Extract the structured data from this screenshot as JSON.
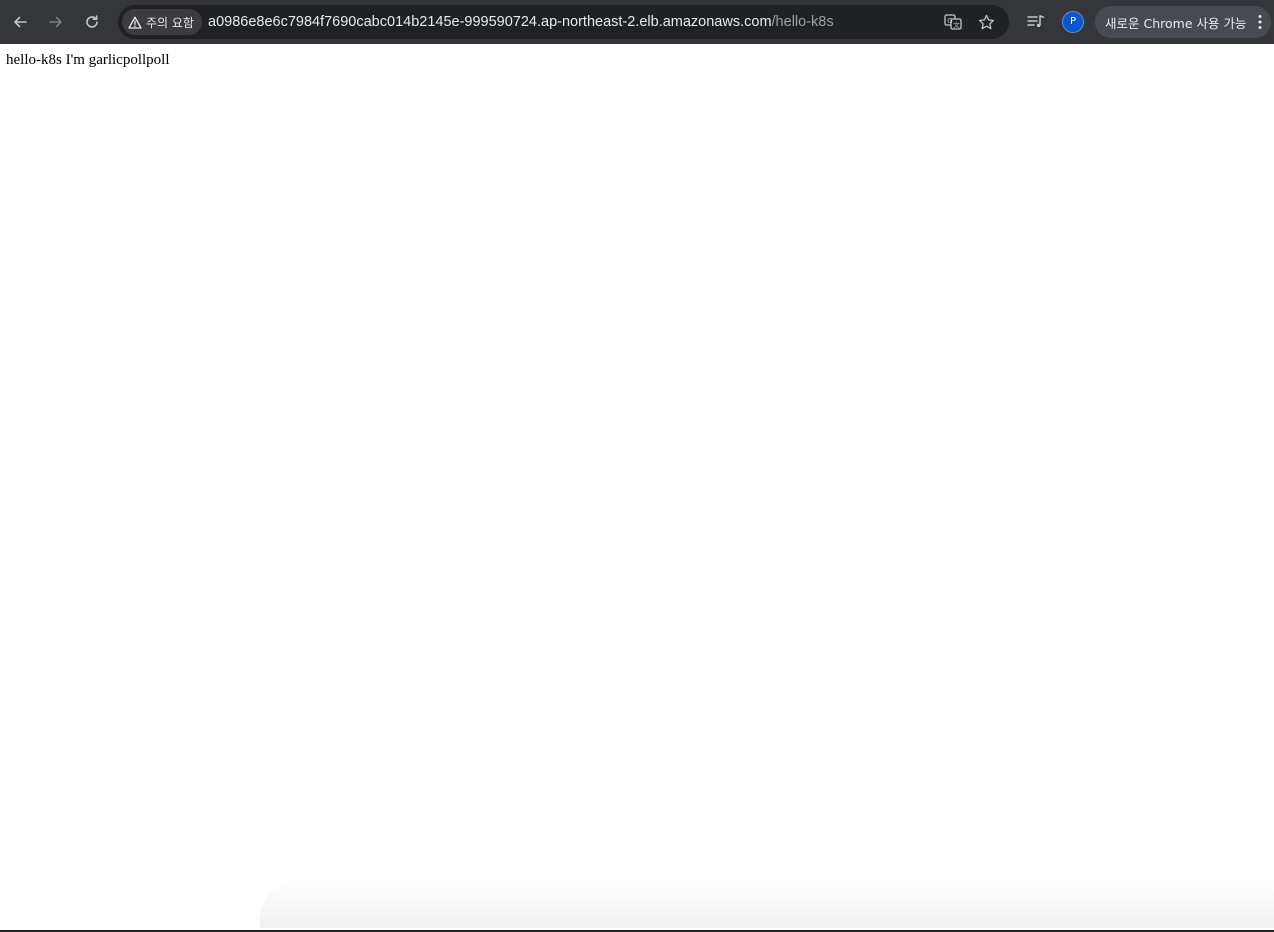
{
  "browser": {
    "security_chip_label": "주의 요함",
    "url_host": "a0986e8e6c7984f7690cabc014b2145e-999590724.ap-northeast-2.elb.amazonaws.com",
    "url_path": "/hello-k8s",
    "profile_initial": "P",
    "update_label": "새로운 Chrome 사용 가능",
    "icons": {
      "back": "arrow-left-icon",
      "forward": "arrow-right-icon",
      "reload": "reload-icon",
      "warning": "warning-triangle-icon",
      "translate": "translate-icon",
      "bookmark": "star-icon",
      "media": "media-queue-icon",
      "menu": "kebab-menu-icon"
    },
    "colors": {
      "toolbar": "#35363a",
      "omnibox": "#202124",
      "avatar": "#0b57d0"
    }
  },
  "page": {
    "text": "hello-k8s I'm garlicpollpoll"
  }
}
